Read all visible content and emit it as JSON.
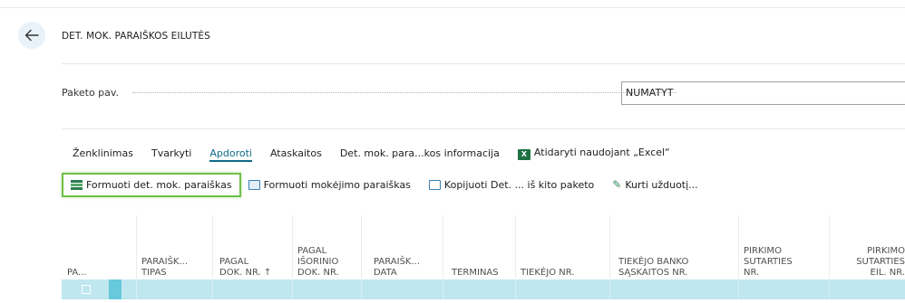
{
  "page": {
    "title": "DET. MOK. PARAIŠKOS EILUTĖS"
  },
  "field": {
    "label": "Paketo pav.",
    "value": "NUMATYT"
  },
  "tabs": [
    {
      "label": "Ženklinimas"
    },
    {
      "label": "Tvarkyti"
    },
    {
      "label": "Apdoroti",
      "active": true
    },
    {
      "label": "Ataskaitos"
    },
    {
      "label": "Det. mok. para...kos informacija"
    },
    {
      "label": "Atidaryti naudojant „Excel“"
    }
  ],
  "actions": [
    {
      "label": "Formuoti det. mok. paraiškas",
      "icon": "grid-green-icon",
      "highlighted": true
    },
    {
      "label": "Formuoti mokėjimo paraiškas",
      "icon": "document-icon"
    },
    {
      "label": "Kopijuoti Det. ... iš kito paketo",
      "icon": "copy-icon"
    },
    {
      "label": "Kurti užduotį...",
      "icon": "wrench-icon"
    }
  ],
  "columns": [
    {
      "lines": [
        "PA..."
      ]
    },
    {
      "lines": [
        "PARAIŠK...",
        "TIPAS"
      ]
    },
    {
      "lines": [
        "PAGAL",
        "DOK. NR. ↑"
      ]
    },
    {
      "lines": [
        "PAGAL",
        "IŠORINIO",
        "DOK. NR."
      ]
    },
    {
      "lines": [
        "PARAIŠK...",
        "DATA"
      ]
    },
    {
      "lines": [
        "TERMINAS"
      ]
    },
    {
      "lines": [
        "TIEKĖJO NR."
      ]
    },
    {
      "lines": [
        "TIEKĖJO BANKO",
        "SĄSKAITOS NR."
      ]
    },
    {
      "lines": [
        "PIRKIMO",
        "SUTARTIES",
        "NR."
      ]
    },
    {
      "lines": [
        "PIRKIMO",
        "SUTARTIES",
        "EIL. NR."
      ]
    }
  ],
  "colors": {
    "accent": "#0f6a8a",
    "highlight_border": "#70c04a",
    "row_selected": "#bfe7ef",
    "row_marker": "#67c9dc"
  }
}
